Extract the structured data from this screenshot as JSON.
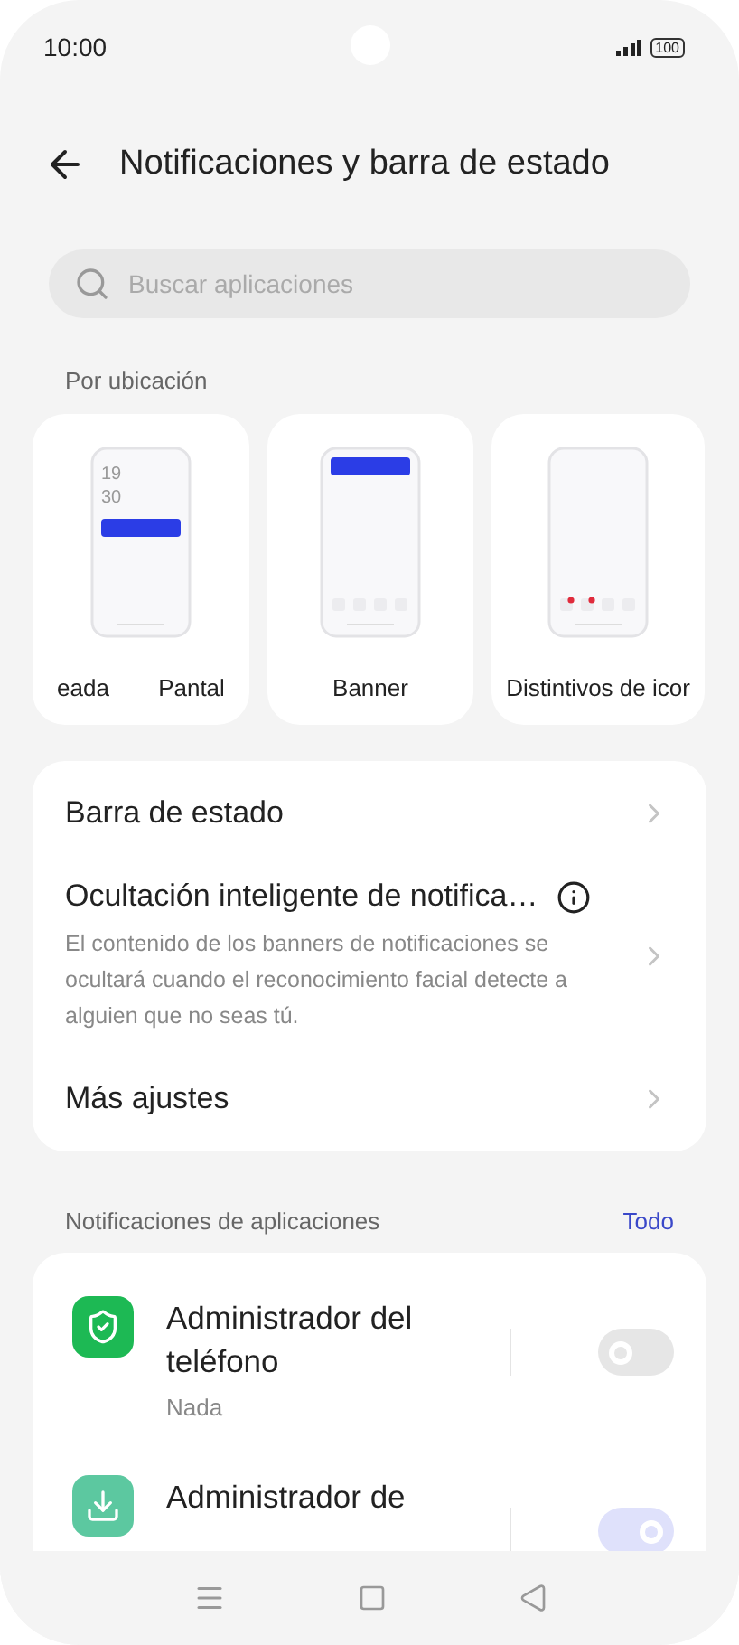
{
  "status_bar": {
    "time": "10:00",
    "battery": "100"
  },
  "header": {
    "title": "Notificaciones y barra de estado"
  },
  "search": {
    "placeholder": "Buscar aplicaciones"
  },
  "placement": {
    "label": "Por ubicación",
    "cards": [
      {
        "kind": "lockscreen",
        "labels": [
          "eada",
          "Pantal"
        ],
        "clock": [
          "19",
          "30"
        ]
      },
      {
        "kind": "banner",
        "labels": [
          "Banner"
        ]
      },
      {
        "kind": "badges",
        "labels": [
          "Distintivos de icor"
        ]
      }
    ]
  },
  "settings": [
    {
      "title": "Barra de estado"
    },
    {
      "title": "Ocultación inteligente de notifica…",
      "info": true,
      "description": "El contenido de los banners de notificaciones se ocultará cuando el reconocimiento facial detecte a alguien que no seas tú."
    },
    {
      "title": "Más ajustes"
    }
  ],
  "apps_section": {
    "label": "Notificaciones de aplicaciones",
    "link": "Todo"
  },
  "apps": [
    {
      "kind": "shield",
      "name": "Administrador del teléfono",
      "subtitle": "Nada",
      "on": false
    },
    {
      "kind": "download",
      "name": "Administrador de",
      "on": true
    }
  ]
}
